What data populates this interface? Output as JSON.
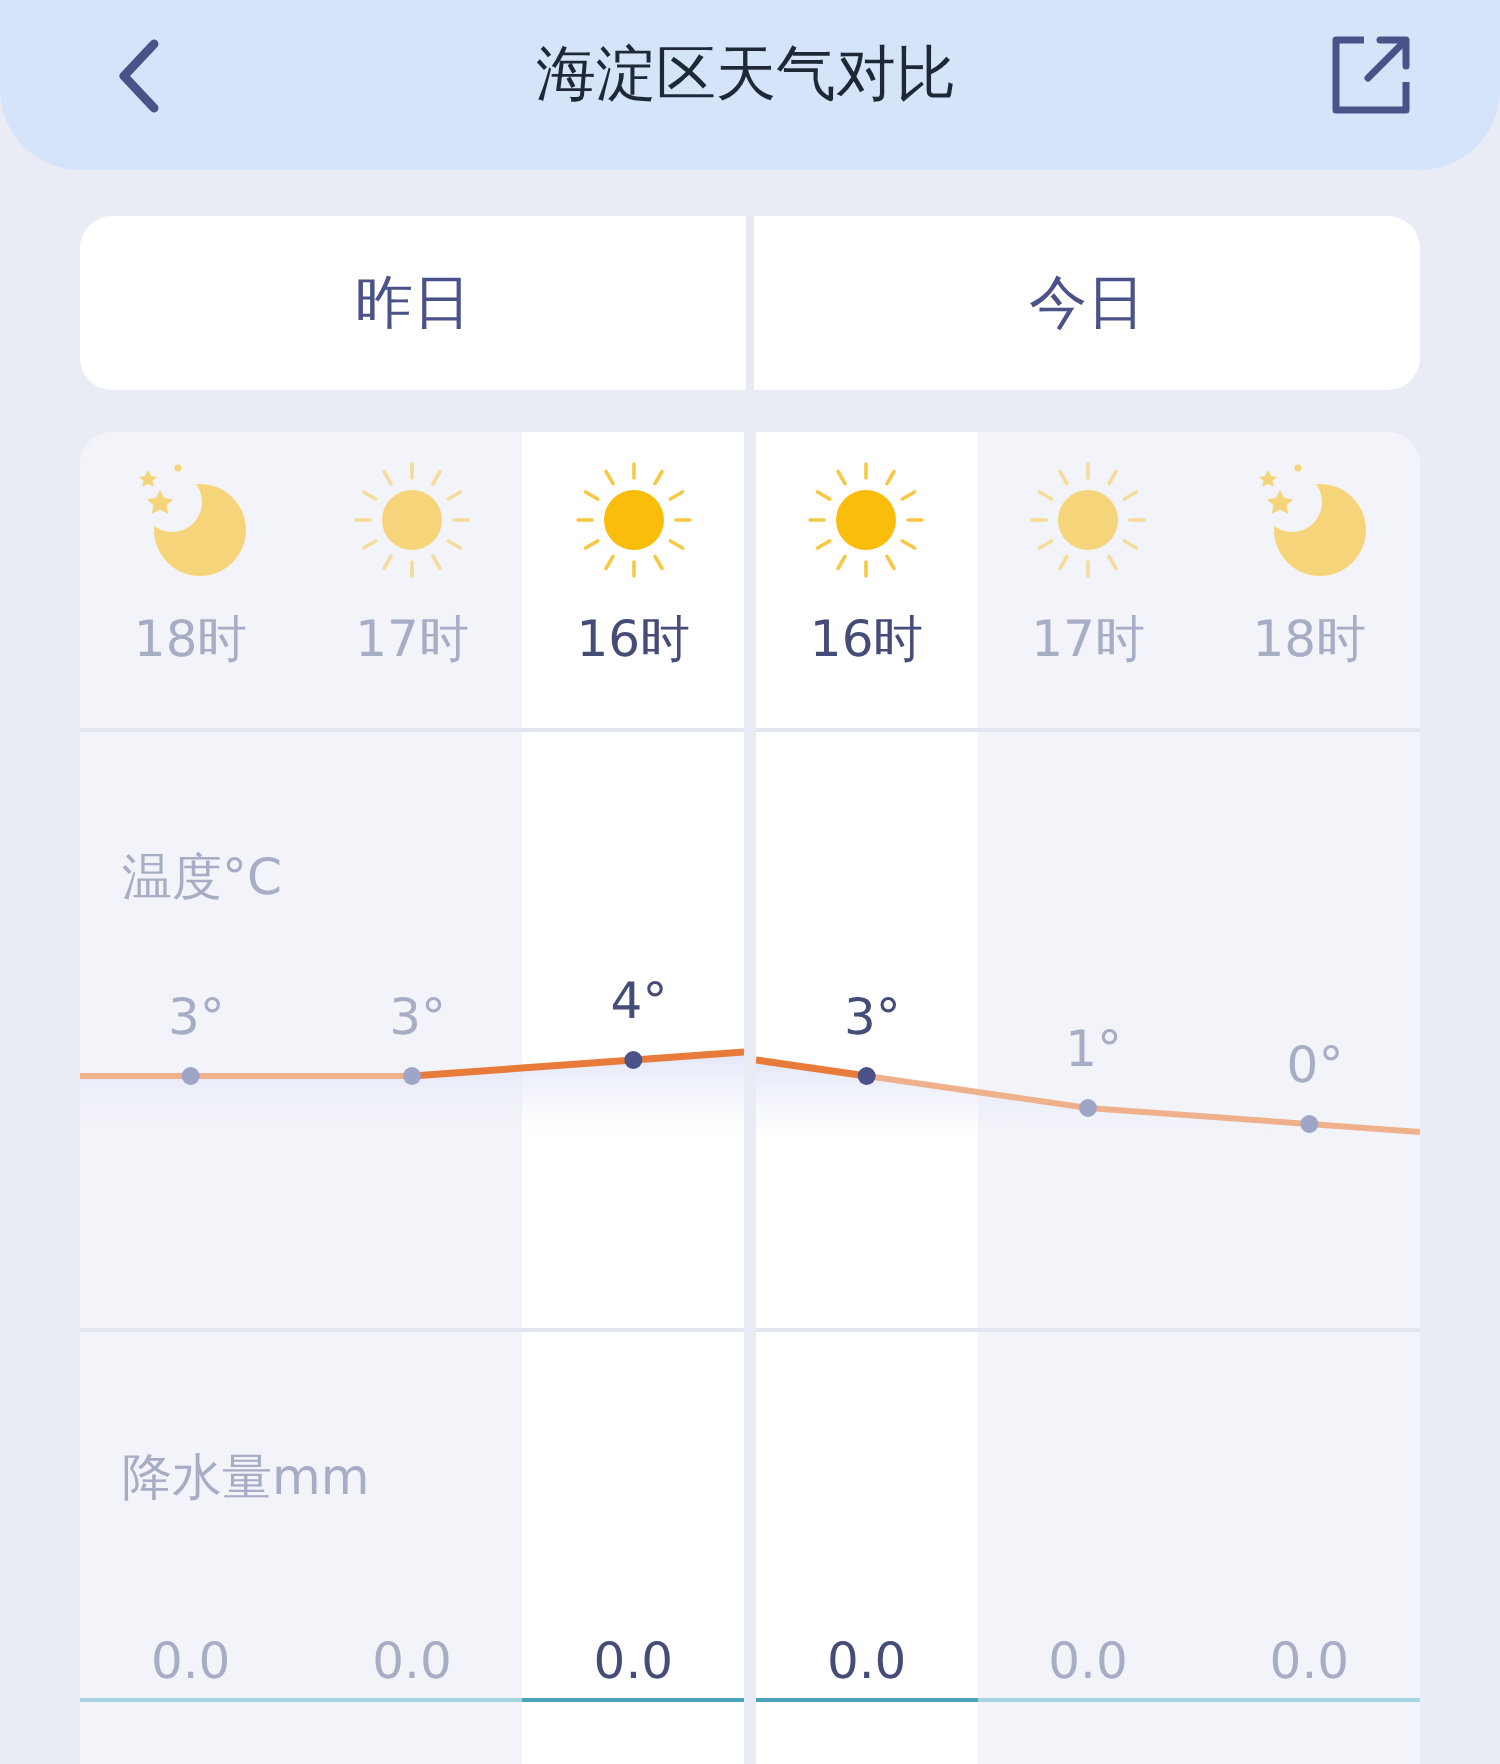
{
  "header": {
    "title": "海淀区天气对比"
  },
  "days": [
    {
      "label": "昨日",
      "hours": [
        {
          "hour": "18时",
          "kind": "moon",
          "current": false,
          "temp": "3°",
          "precip": "0.0"
        },
        {
          "hour": "17时",
          "kind": "sun",
          "current": false,
          "temp": "3°",
          "precip": "0.0"
        },
        {
          "hour": "16时",
          "kind": "sun",
          "current": true,
          "temp": "4°",
          "precip": "0.0"
        }
      ]
    },
    {
      "label": "今日",
      "hours": [
        {
          "hour": "16时",
          "kind": "sun",
          "current": true,
          "temp": "3°",
          "precip": "0.0"
        },
        {
          "hour": "17时",
          "kind": "sun",
          "current": false,
          "temp": "1°",
          "precip": "0.0"
        },
        {
          "hour": "18时",
          "kind": "moon",
          "current": false,
          "temp": "0°",
          "precip": "0.0"
        }
      ]
    }
  ],
  "row_labels": {
    "temperature": "温度°C",
    "precipitation": "降水量mm"
  }
}
